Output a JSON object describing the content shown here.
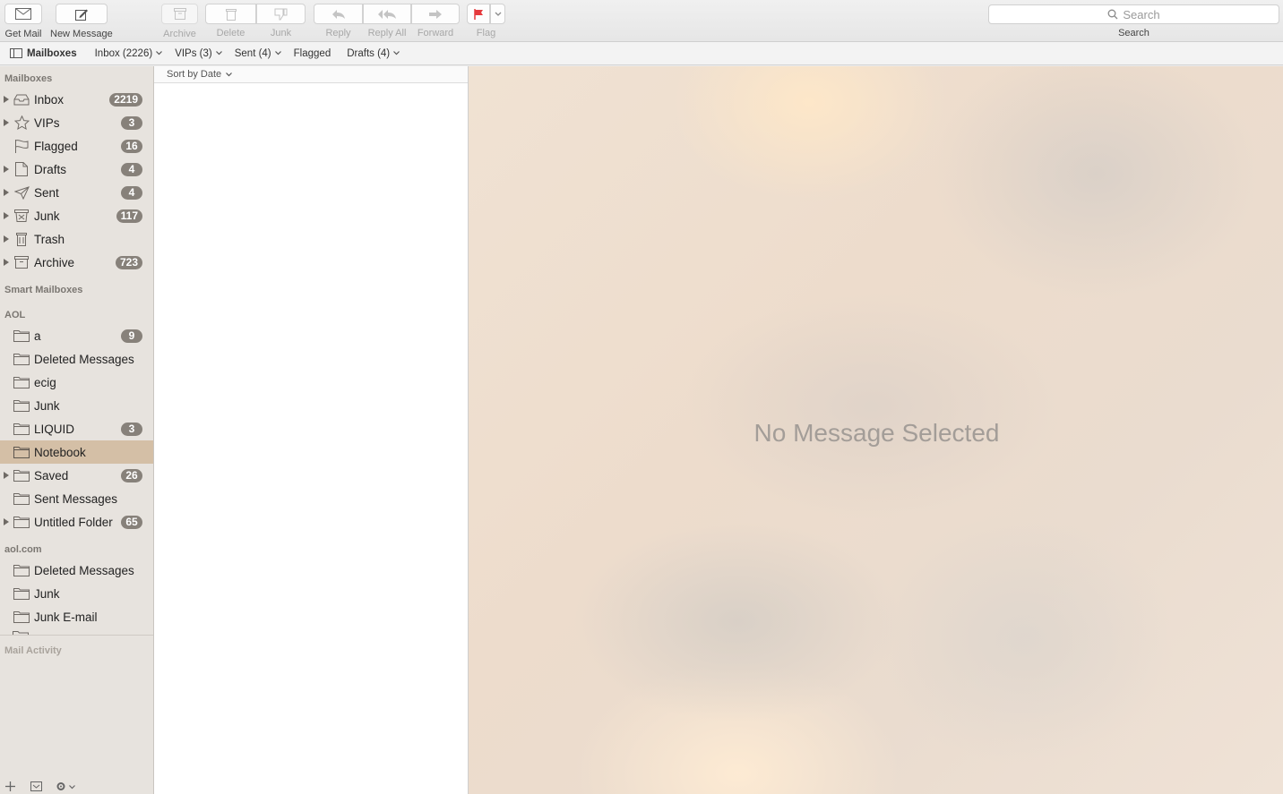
{
  "toolbar": {
    "get_mail": "Get Mail",
    "new_message": "New Message",
    "archive": "Archive",
    "delete": "Delete",
    "junk": "Junk",
    "reply": "Reply",
    "reply_all": "Reply All",
    "forward": "Forward",
    "flag": "Flag",
    "search_placeholder": "Search",
    "search_label": "Search",
    "flag_color": "#e5393d"
  },
  "favorites": {
    "mailboxes": "Mailboxes",
    "inbox": "Inbox (2226)",
    "vips": "VIPs (3)",
    "sent": "Sent (4)",
    "flagged": "Flagged",
    "drafts": "Drafts (4)"
  },
  "sidebar": {
    "mailboxes_title": "Mailboxes",
    "mailboxes": [
      {
        "label": "Inbox",
        "badge": "2219",
        "icon": "inbox-icon"
      },
      {
        "label": "VIPs",
        "badge": "3",
        "icon": "star-icon"
      },
      {
        "label": "Flagged",
        "badge": "16",
        "icon": "flag-icon"
      },
      {
        "label": "Drafts",
        "badge": "4",
        "icon": "drafts-icon"
      },
      {
        "label": "Sent",
        "badge": "4",
        "icon": "paper-plane-icon"
      },
      {
        "label": "Junk",
        "badge": "117",
        "icon": "junk-icon"
      },
      {
        "label": "Trash",
        "badge": "",
        "icon": "trash-icon"
      },
      {
        "label": "Archive",
        "badge": "723",
        "icon": "archive-icon"
      }
    ],
    "smart_title": "Smart Mailboxes",
    "aol_title": "AOL",
    "aol": [
      {
        "label": "a",
        "badge": "9"
      },
      {
        "label": "Deleted Messages",
        "badge": ""
      },
      {
        "label": "ecig",
        "badge": ""
      },
      {
        "label": "Junk",
        "badge": ""
      },
      {
        "label": "LIQUID",
        "badge": "3"
      },
      {
        "label": "Notebook",
        "badge": ""
      },
      {
        "label": "Saved",
        "badge": "26"
      },
      {
        "label": "Sent Messages",
        "badge": ""
      },
      {
        "label": "Untitled Folder",
        "badge": "65"
      }
    ],
    "aolcom_title": "aol.com",
    "aolcom": [
      {
        "label": "Deleted Messages"
      },
      {
        "label": "Junk"
      },
      {
        "label": "Junk E-mail"
      }
    ],
    "mail_activity": "Mail Activity"
  },
  "message_list": {
    "sort_label": "Sort by Date"
  },
  "viewer": {
    "empty_text": "No Message Selected"
  }
}
